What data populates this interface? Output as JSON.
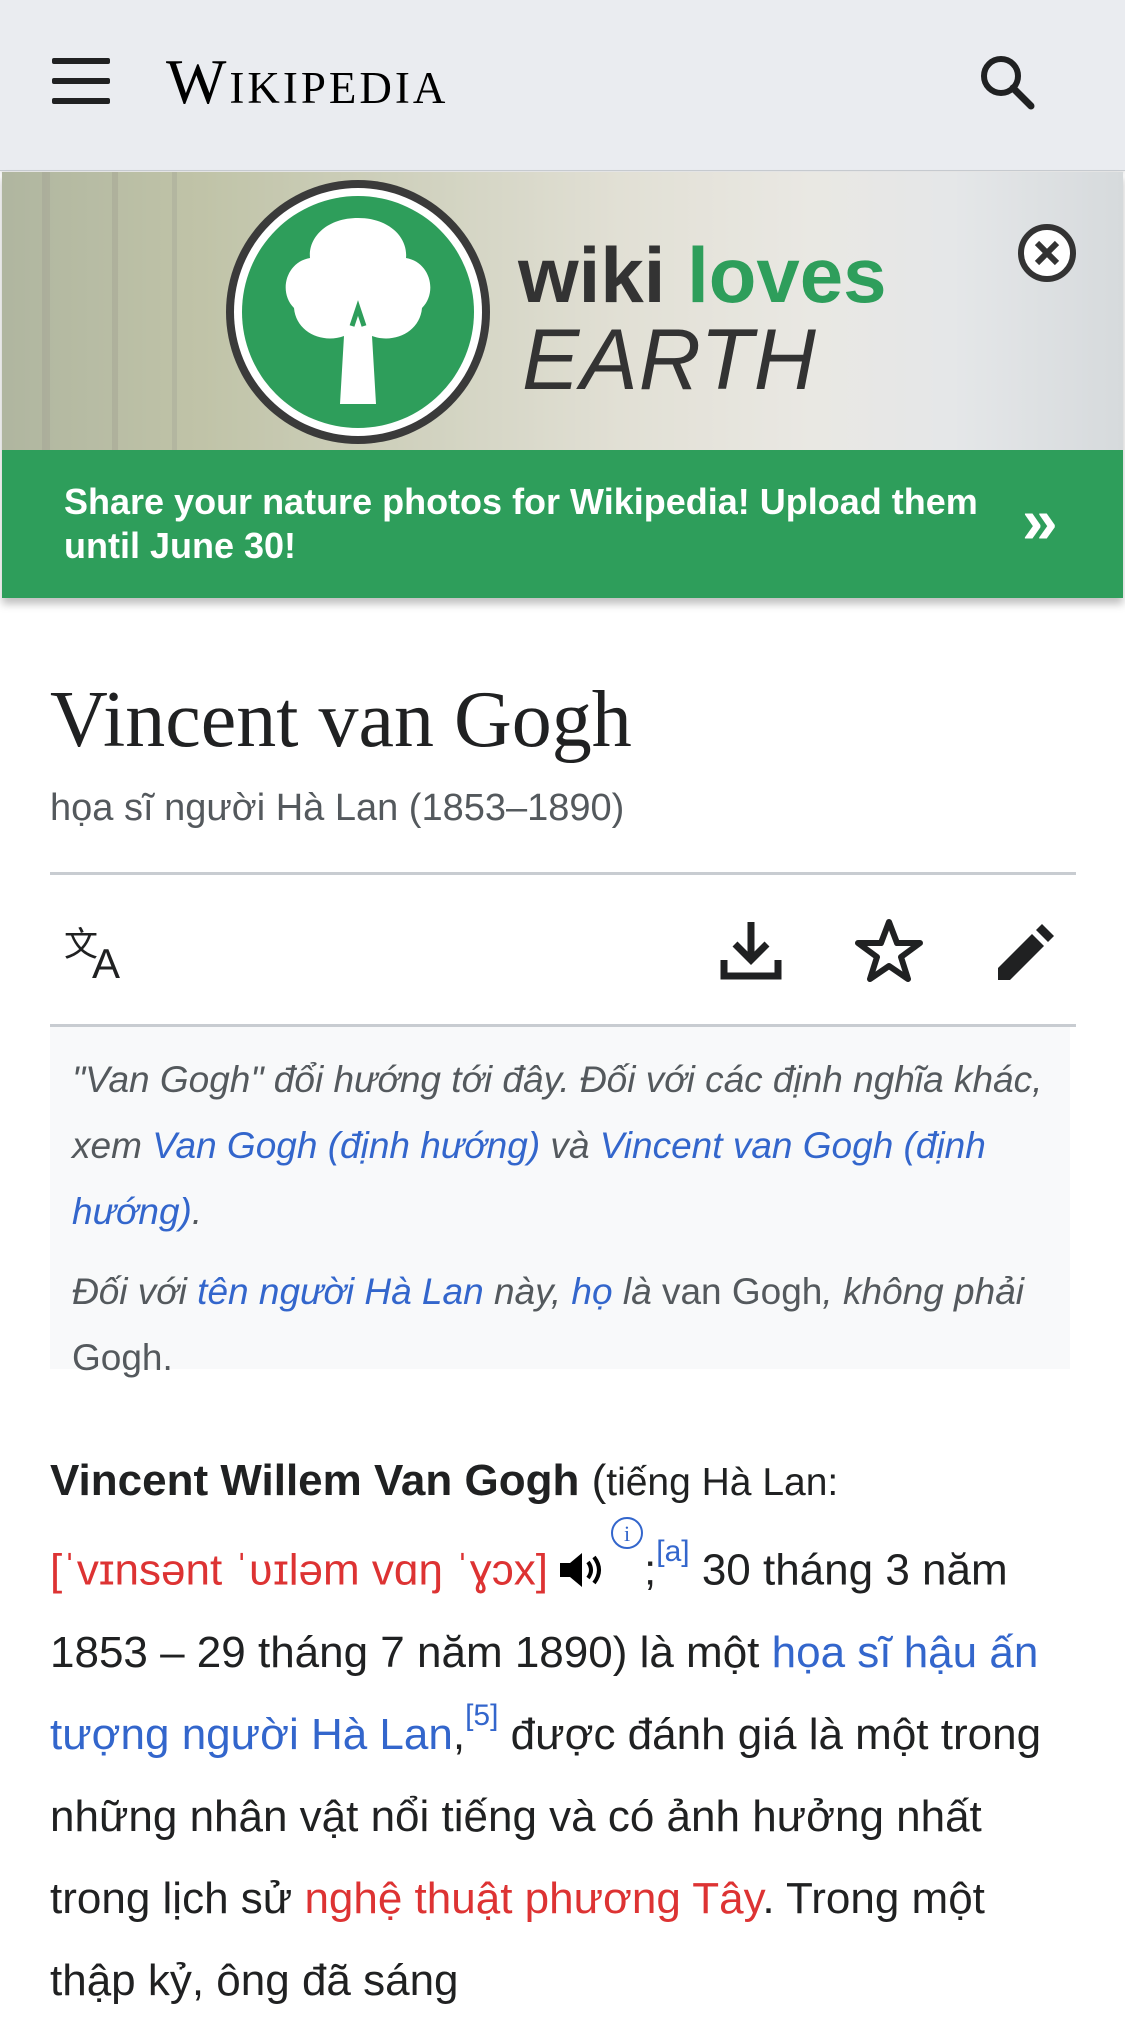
{
  "header": {
    "wordmark": "Wikipedia",
    "menu_icon": "hamburger-menu-icon",
    "search_icon": "search-icon"
  },
  "banner": {
    "brand_word1": "wiki",
    "brand_word2": "loves",
    "brand_word3": "EARTH",
    "message": "Share your nature photos for Wikipedia! Upload them until June 30!",
    "arrow": "»",
    "accent_color": "#2e9e5b",
    "close_icon": "close-circle-icon"
  },
  "page": {
    "title": "Vincent van Gogh",
    "description": "họa sĩ người Hà Lan (1853–1890)"
  },
  "toolbar": {
    "icons": [
      "language-icon",
      "download-icon",
      "watchlist-star-icon",
      "edit-pencil-icon"
    ]
  },
  "hatnote": {
    "line1_a": "\"Van Gogh\" đổi hướng tới đây. Đối với các định nghĩa khác, xem ",
    "link1": "Van Gogh (định hướng)",
    "line1_b": " và ",
    "link2": "Vincent van Gogh (định hướng)",
    "line1_c": ".",
    "line2_a": "Đối với ",
    "link3": "tên người Hà Lan",
    "line2_b": " này, ",
    "link4": "họ",
    "line2_c": " là ",
    "name_full": "van Gogh",
    "line2_d": ", không phải ",
    "name_short": "Gogh",
    "line2_e": "."
  },
  "lead": {
    "bold_name": "Vincent Willem Van Gogh",
    "paren_open": " (",
    "lang_label": "tiếng Hà Lan:",
    "ipa": "[ˈvɪnsənt ˈʋɪləm vɑŋ ˈɣɔx]",
    "info_mark": "i",
    "semicolon": ";",
    "ref_a": "[a]",
    "text1": " 30 tháng 3 năm 1853 – 29 tháng 7 năm 1890) là một ",
    "link_painter": "họa sĩ hậu ấn tượng người Hà Lan",
    "comma": ",",
    "ref_5": "[5]",
    "text2": " được đánh giá là một trong những nhân vật nổi tiếng và có ảnh hưởng nhất trong lịch sử ",
    "link_art": "nghệ thuật phương Tây",
    "text3": ". Trong một thập kỷ, ông đã sáng"
  }
}
